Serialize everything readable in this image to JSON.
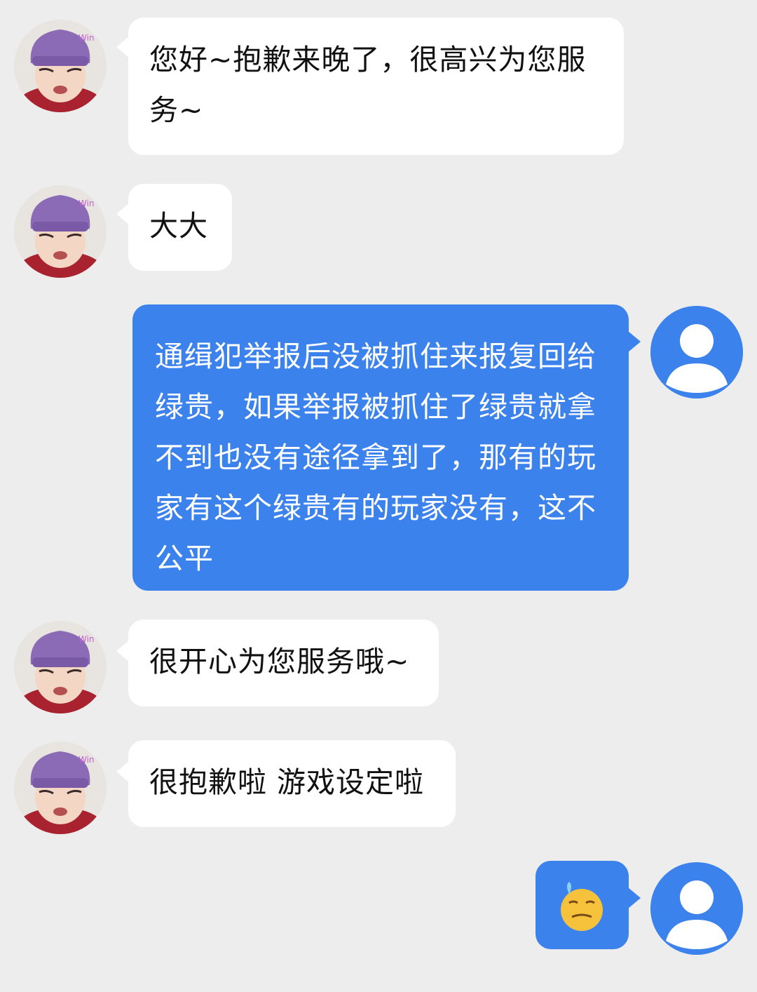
{
  "colors": {
    "background": "#ededed",
    "incoming_bubble": "#ffffff",
    "outgoing_bubble": "#3b82ec",
    "avatar_placeholder": "#3b82ec"
  },
  "kid_avatar_watermark": "Win",
  "messages": [
    {
      "sender": "agent",
      "text": "您好~抱歉来晚了，很高兴为您服务~"
    },
    {
      "sender": "agent",
      "text": "大大"
    },
    {
      "sender": "user",
      "text": "通缉犯举报后没被抓住来报复回给绿贵，如果举报被抓住了绿贵就拿不到也没有途径拿到了，那有的玩家有这个绿贵有的玩家没有，这不公平"
    },
    {
      "sender": "agent",
      "text": "很开心为您服务哦~"
    },
    {
      "sender": "agent",
      "text": "很抱歉啦 游戏设定啦"
    },
    {
      "sender": "user",
      "icon": "sweat-emoji-icon"
    }
  ]
}
